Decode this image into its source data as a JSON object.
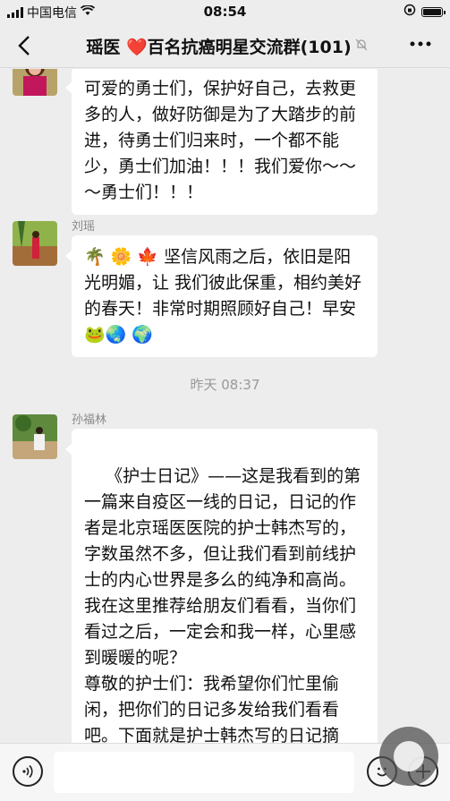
{
  "status_bar": {
    "carrier": "中国电信",
    "time": "08:54"
  },
  "nav": {
    "back_icon": "chevron-left-icon",
    "title": "瑶医 ❤️百名抗癌明星交流群(101)",
    "mute_icon": "bell-off-icon",
    "more_icon": "ellipsis-icon"
  },
  "messages": [
    {
      "sender": "",
      "text": "可爱的勇士们，保护好自己，去救更多的人，做好防御是为了大踏步的前进，待勇士们归来时，一个都不能少，勇士们加油！！！我们爱你～～～勇士们！！！"
    },
    {
      "sender": "刘瑶",
      "text": "🌴 🌼 🍁 坚信风雨之后，依旧是阳光明媚，让 我们彼此保重，相约美好的春天！非常时期照顾好自己！早安🐸🌏 🌍"
    },
    {
      "timestamp": "昨天 08:37"
    },
    {
      "sender": "孙福林",
      "text": "《护士日记》——这是我看到的第一篇来自疫区一线的日记，日记的作者是北京瑶医医院的护士韩杰写的，字数虽然不多，但让我们看到前线护士的内心世界是多么的纯净和高尚。我在这里推荐给朋友们看看，当你们看过之后，一定会和我一样，心里感到暖暖的呢？\n尊敬的护士们：我希望你们忙里偷闲，把你们的日记多发给我们看看吧。下面就是护士韩杰写的日记摘抄："
    }
  ],
  "input_bar": {
    "voice_icon": "voice-icon",
    "emoji_icon": "emoji-icon",
    "plus_icon": "plus-icon"
  }
}
